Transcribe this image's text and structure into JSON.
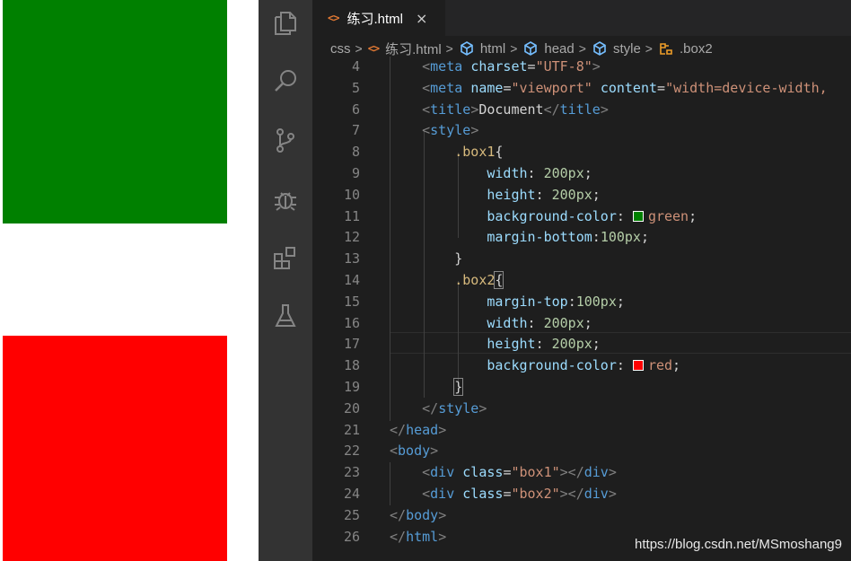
{
  "preview": {
    "box1_color": "#008000",
    "box2_color": "#ff0000"
  },
  "activity_bar": {
    "icons": [
      "explorer-icon",
      "search-icon",
      "source-control-icon",
      "debug-icon",
      "extensions-icon",
      "testing-icon"
    ]
  },
  "tab": {
    "icon": "<>",
    "label": "练习.html",
    "close": "×"
  },
  "breadcrumb": {
    "items": [
      {
        "label": "css",
        "icon": ""
      },
      {
        "label": "练习.html",
        "icon": "html-file-icon"
      },
      {
        "label": "html",
        "icon": "element-icon"
      },
      {
        "label": "head",
        "icon": "element-icon"
      },
      {
        "label": "style",
        "icon": "element-icon"
      },
      {
        "label": ".box2",
        "icon": "css-rule-icon"
      }
    ],
    "separator": ">"
  },
  "colors": {
    "green": "#008000",
    "red": "#ff0000",
    "editor_bg": "#1e1e1e",
    "activity_bg": "#333333"
  },
  "code": {
    "lines": [
      {
        "n": "4",
        "tokens": [
          [
            "    ",
            "tk-text"
          ],
          [
            "<",
            "tk-bracket"
          ],
          [
            "meta",
            "tk-tag"
          ],
          [
            " ",
            "tk-text"
          ],
          [
            "charset",
            "tk-attr"
          ],
          [
            "=",
            "tk-text"
          ],
          [
            "\"UTF-8\"",
            "tk-str"
          ],
          [
            ">",
            "tk-bracket"
          ]
        ]
      },
      {
        "n": "5",
        "tokens": [
          [
            "    ",
            "tk-text"
          ],
          [
            "<",
            "tk-bracket"
          ],
          [
            "meta",
            "tk-tag"
          ],
          [
            " ",
            "tk-text"
          ],
          [
            "name",
            "tk-attr"
          ],
          [
            "=",
            "tk-text"
          ],
          [
            "\"viewport\"",
            "tk-str"
          ],
          [
            " ",
            "tk-text"
          ],
          [
            "content",
            "tk-attr"
          ],
          [
            "=",
            "tk-text"
          ],
          [
            "\"width=device-width,",
            "tk-str"
          ]
        ]
      },
      {
        "n": "6",
        "tokens": [
          [
            "    ",
            "tk-text"
          ],
          [
            "<",
            "tk-bracket"
          ],
          [
            "title",
            "tk-tag"
          ],
          [
            ">",
            "tk-bracket"
          ],
          [
            "Document",
            "tk-text"
          ],
          [
            "</",
            "tk-bracket"
          ],
          [
            "title",
            "tk-tag"
          ],
          [
            ">",
            "tk-bracket"
          ]
        ]
      },
      {
        "n": "7",
        "tokens": [
          [
            "    ",
            "tk-text"
          ],
          [
            "<",
            "tk-bracket"
          ],
          [
            "style",
            "tk-tag"
          ],
          [
            ">",
            "tk-bracket"
          ]
        ]
      },
      {
        "n": "8",
        "tokens": [
          [
            "        ",
            "tk-text"
          ],
          [
            ".box1",
            "tk-sel"
          ],
          [
            "{",
            "tk-text"
          ]
        ]
      },
      {
        "n": "9",
        "tokens": [
          [
            "            ",
            "tk-text"
          ],
          [
            "width",
            "tk-prop"
          ],
          [
            ": ",
            "tk-text"
          ],
          [
            "200px",
            "tk-num"
          ],
          [
            ";",
            "tk-text"
          ]
        ]
      },
      {
        "n": "10",
        "tokens": [
          [
            "            ",
            "tk-text"
          ],
          [
            "height",
            "tk-prop"
          ],
          [
            ": ",
            "tk-text"
          ],
          [
            "200px",
            "tk-num"
          ],
          [
            ";",
            "tk-text"
          ]
        ]
      },
      {
        "n": "11",
        "tokens": [
          [
            "            ",
            "tk-text"
          ],
          [
            "background-color",
            "tk-prop"
          ],
          [
            ": ",
            "tk-text"
          ],
          [
            "#swatch-green",
            "swatch"
          ],
          [
            "green",
            "tk-str"
          ],
          [
            ";",
            "tk-text"
          ]
        ]
      },
      {
        "n": "12",
        "tokens": [
          [
            "            ",
            "tk-text"
          ],
          [
            "margin-bottom",
            "tk-prop"
          ],
          [
            ":",
            "tk-text"
          ],
          [
            "100px",
            "tk-num"
          ],
          [
            ";",
            "tk-text"
          ]
        ]
      },
      {
        "n": "13",
        "tokens": [
          [
            "        ",
            "tk-text"
          ],
          [
            "}",
            "tk-text"
          ]
        ]
      },
      {
        "n": "14",
        "tokens": [
          [
            "        ",
            "tk-text"
          ],
          [
            ".box2",
            "tk-sel"
          ],
          [
            "{",
            "tk-text"
          ]
        ]
      },
      {
        "n": "15",
        "tokens": [
          [
            "            ",
            "tk-text"
          ],
          [
            "margin-top",
            "tk-prop"
          ],
          [
            ":",
            "tk-text"
          ],
          [
            "100px",
            "tk-num"
          ],
          [
            ";",
            "tk-text"
          ]
        ]
      },
      {
        "n": "16",
        "tokens": [
          [
            "            ",
            "tk-text"
          ],
          [
            "width",
            "tk-prop"
          ],
          [
            ": ",
            "tk-text"
          ],
          [
            "200px",
            "tk-num"
          ],
          [
            ";",
            "tk-text"
          ]
        ]
      },
      {
        "n": "17",
        "tokens": [
          [
            "            ",
            "tk-text"
          ],
          [
            "height",
            "tk-prop"
          ],
          [
            ": ",
            "tk-text"
          ],
          [
            "200px",
            "tk-num"
          ],
          [
            ";",
            "tk-text"
          ]
        ]
      },
      {
        "n": "18",
        "tokens": [
          [
            "            ",
            "tk-text"
          ],
          [
            "background-color",
            "tk-prop"
          ],
          [
            ": ",
            "tk-text"
          ],
          [
            "#swatch-red",
            "swatch"
          ],
          [
            "red",
            "tk-str"
          ],
          [
            ";",
            "tk-text"
          ]
        ]
      },
      {
        "n": "19",
        "tokens": [
          [
            "        ",
            "tk-text"
          ],
          [
            "}",
            "tk-text"
          ]
        ]
      },
      {
        "n": "20",
        "tokens": [
          [
            "    ",
            "tk-text"
          ],
          [
            "</",
            "tk-bracket"
          ],
          [
            "style",
            "tk-tag"
          ],
          [
            ">",
            "tk-bracket"
          ]
        ]
      },
      {
        "n": "21",
        "tokens": [
          [
            "</",
            "tk-bracket"
          ],
          [
            "head",
            "tk-tag"
          ],
          [
            ">",
            "tk-bracket"
          ]
        ]
      },
      {
        "n": "22",
        "tokens": [
          [
            "<",
            "tk-bracket"
          ],
          [
            "body",
            "tk-tag"
          ],
          [
            ">",
            "tk-bracket"
          ]
        ]
      },
      {
        "n": "23",
        "tokens": [
          [
            "    ",
            "tk-text"
          ],
          [
            "<",
            "tk-bracket"
          ],
          [
            "div",
            "tk-tag"
          ],
          [
            " ",
            "tk-text"
          ],
          [
            "class",
            "tk-attr"
          ],
          [
            "=",
            "tk-text"
          ],
          [
            "\"box1\"",
            "tk-str"
          ],
          [
            "></",
            "tk-bracket"
          ],
          [
            "div",
            "tk-tag"
          ],
          [
            ">",
            "tk-bracket"
          ]
        ]
      },
      {
        "n": "24",
        "tokens": [
          [
            "    ",
            "tk-text"
          ],
          [
            "<",
            "tk-bracket"
          ],
          [
            "div",
            "tk-tag"
          ],
          [
            " ",
            "tk-text"
          ],
          [
            "class",
            "tk-attr"
          ],
          [
            "=",
            "tk-text"
          ],
          [
            "\"box2\"",
            "tk-str"
          ],
          [
            "></",
            "tk-bracket"
          ],
          [
            "div",
            "tk-tag"
          ],
          [
            ">",
            "tk-bracket"
          ]
        ]
      },
      {
        "n": "25",
        "tokens": [
          [
            "</",
            "tk-bracket"
          ],
          [
            "body",
            "tk-tag"
          ],
          [
            ">",
            "tk-bracket"
          ]
        ]
      },
      {
        "n": "26",
        "tokens": [
          [
            "</",
            "tk-bracket"
          ],
          [
            "html",
            "tk-tag"
          ],
          [
            ">",
            "tk-bracket"
          ]
        ]
      }
    ]
  },
  "watermark": "https://blog.csdn.net/MSmoshang9"
}
